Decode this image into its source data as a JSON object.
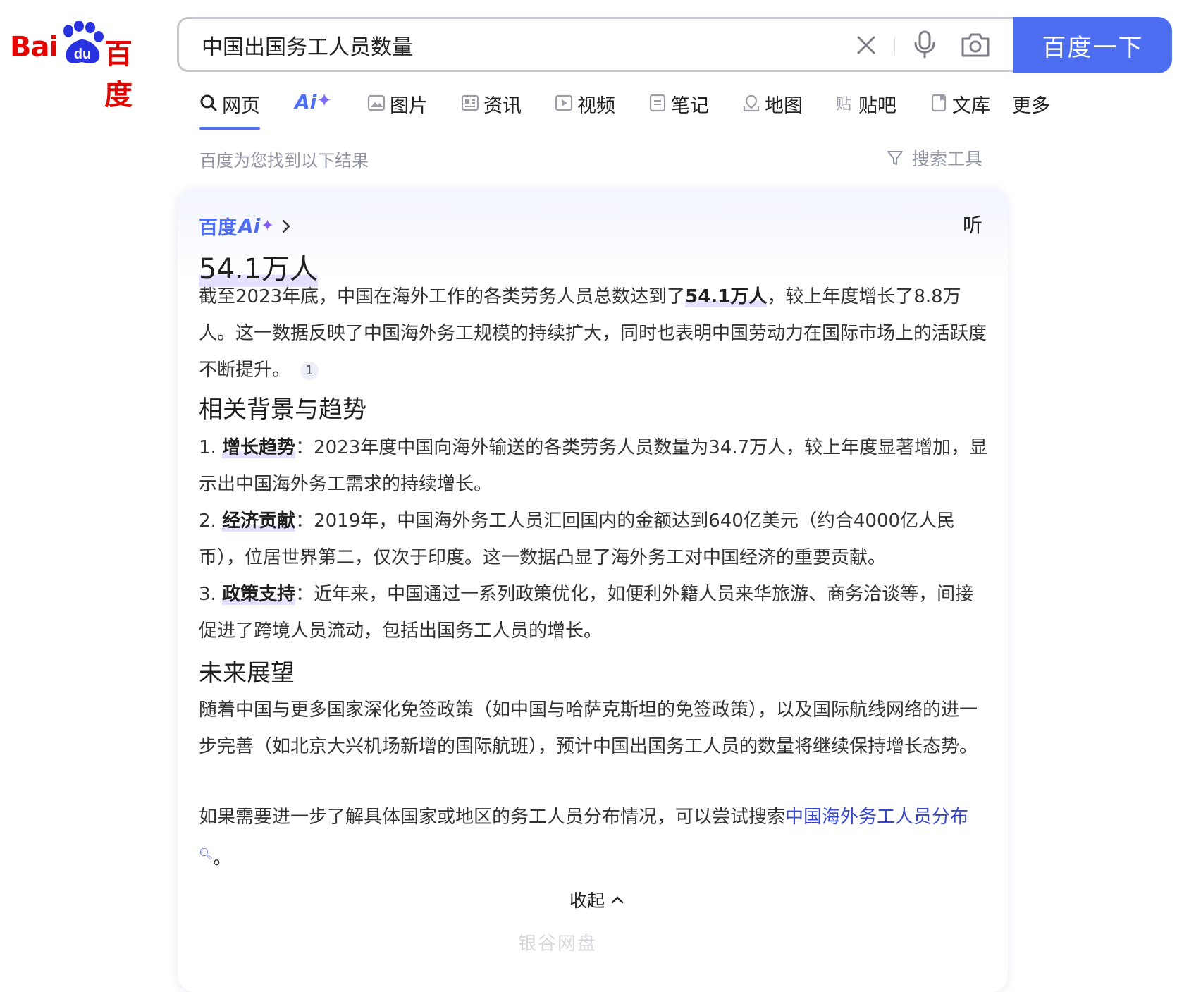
{
  "logo": {
    "latin": "Bai",
    "du": "du",
    "chinese": "百度"
  },
  "search": {
    "query": "中国出国务工人员数量",
    "button_label": "百度一下"
  },
  "tabs": [
    {
      "label": "网页",
      "icon": "search-icon",
      "active": true
    },
    {
      "label": "Ai",
      "icon": "ai-spark-icon"
    },
    {
      "label": "图片",
      "icon": "image-icon"
    },
    {
      "label": "资讯",
      "icon": "news-icon"
    },
    {
      "label": "视频",
      "icon": "video-icon"
    },
    {
      "label": "笔记",
      "icon": "note-icon"
    },
    {
      "label": "地图",
      "icon": "map-icon"
    },
    {
      "label": "贴吧",
      "icon": "tieba-icon"
    },
    {
      "label": "文库",
      "icon": "wenku-icon"
    },
    {
      "label": "更多"
    }
  ],
  "results": {
    "count_text": "百度为您找到以下结果",
    "tools_label": "搜索工具"
  },
  "ai_card": {
    "brand": "百度",
    "brand_ai": "Ai",
    "listen_label": "听",
    "answer": "54.1万人",
    "intro": {
      "before": "截至2023年底，中国在海外工作的各类劳务人员总数达到了",
      "bold": "54.1万人",
      "after": "，较上年度增长了8.8万人。这一数据反映了中国海外务工规模的持续扩大，同时也表明中国劳动力在国际市场上的活跃度不断提升。",
      "citation": "1"
    },
    "section1_title": "相关背景与趋势",
    "items": [
      {
        "num": "1.",
        "bold": "增长趋势",
        "text": "：2023年度中国向海外输送的各类劳务人员数量为34.7万人，较上年度显著增加，显示出中国海外务工需求的持续增长。"
      },
      {
        "num": "2.",
        "bold": "经济贡献",
        "text": "：2019年，中国海外务工人员汇回国内的金额达到640亿美元（约合4000亿人民币），位居世界第二，仅次于印度。这一数据凸显了海外务工对中国经济的重要贡献。"
      },
      {
        "num": "3.",
        "bold": "政策支持",
        "text": "：近年来，中国通过一系列政策优化，如便利外籍人员来华旅游、商务洽谈等，间接促进了跨境人员流动，包括出国务工人员的增长。"
      }
    ],
    "section2_title": "未来展望",
    "outlook": "随着中国与更多国家深化免签政策（如中国与哈萨克斯坦的免签政策），以及国际航线网络的进一步完善（如北京大兴机场新增的国际航班），预计中国出国务工人员的数量将继续保持增长态势。",
    "suggest": {
      "before": "如果需要进一步了解具体国家或地区的务工人员分布情况，可以尝试搜索",
      "link": "中国海外务工人员分布",
      "after": "。"
    },
    "collapse_label": "收起"
  },
  "watermark": "银谷网盘",
  "colors": {
    "brand_blue": "#4e6ef2",
    "logo_red": "#e10601",
    "link_blue": "#3647c9"
  }
}
